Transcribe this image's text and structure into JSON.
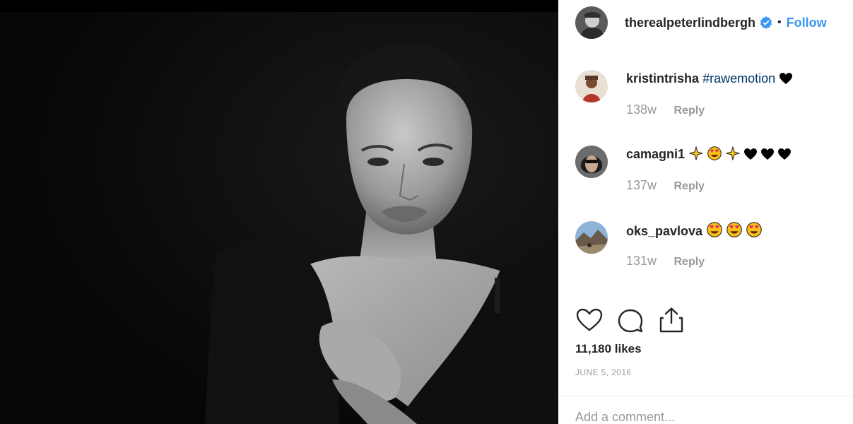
{
  "post": {
    "photo_icon": "portrait-photo"
  },
  "header": {
    "username": "therealpeterlindbergh",
    "dot": "•",
    "follow_label": "Follow",
    "verified_icon": "verified-badge-icon",
    "accent_color": "#3897f0"
  },
  "comments": [
    {
      "username": "kristintrisha",
      "text": "#rawemotion",
      "emoji": "black-heart",
      "time": "138w",
      "reply_label": "Reply"
    },
    {
      "username": "camagni1",
      "text": "",
      "emoji": "sparkle-star, heart-eyes, sparkle-star, black-heart x3",
      "time": "137w",
      "reply_label": "Reply"
    },
    {
      "username": "oks_pavlova",
      "text": "",
      "emoji": "heart-eyes x3",
      "time": "131w",
      "reply_label": "Reply"
    }
  ],
  "actions": {
    "like_icon": "heart-outline-icon",
    "comment_icon": "comment-bubble-icon",
    "share_icon": "share-upload-icon"
  },
  "likes": "11,180 likes",
  "date": "JUNE 5, 2016",
  "add_comment": {
    "placeholder": "Add a comment..."
  }
}
